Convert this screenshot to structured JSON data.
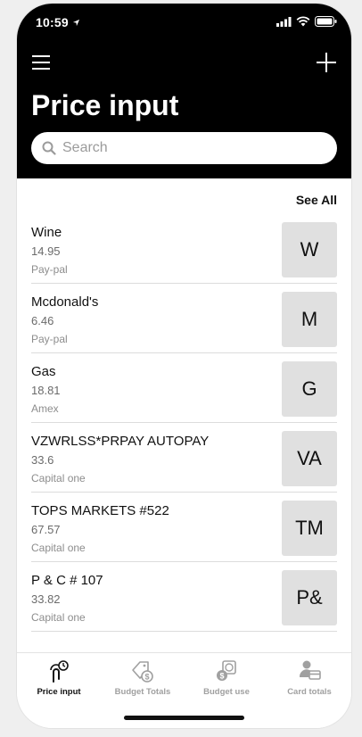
{
  "status": {
    "time": "10:59"
  },
  "header": {
    "title": "Price input"
  },
  "search": {
    "placeholder": "Search"
  },
  "list": {
    "see_all": "See All",
    "items": [
      {
        "name": "Wine",
        "price": "14.95",
        "method": "Pay-pal",
        "initials": "W"
      },
      {
        "name": "Mcdonald's",
        "price": "6.46",
        "method": "Pay-pal",
        "initials": "M"
      },
      {
        "name": "Gas",
        "price": "18.81",
        "method": "Amex",
        "initials": "G"
      },
      {
        "name": "VZWRLSS*PRPAY AUTOPAY",
        "price": "33.6",
        "method": "Capital one",
        "initials": "VA"
      },
      {
        "name": "TOPS MARKETS #522",
        "price": "67.57",
        "method": "Capital one",
        "initials": "TM"
      },
      {
        "name": "P & C # 107",
        "price": "33.82",
        "method": "Capital one",
        "initials": "P&"
      }
    ]
  },
  "tabs": [
    {
      "label": "Price input",
      "icon": "price-input-icon",
      "active": true
    },
    {
      "label": "Budget Totals",
      "icon": "budget-tag-icon",
      "active": false
    },
    {
      "label": "Budget use",
      "icon": "budget-use-icon",
      "active": false
    },
    {
      "label": "Card totals",
      "icon": "card-totals-icon",
      "active": false
    }
  ]
}
